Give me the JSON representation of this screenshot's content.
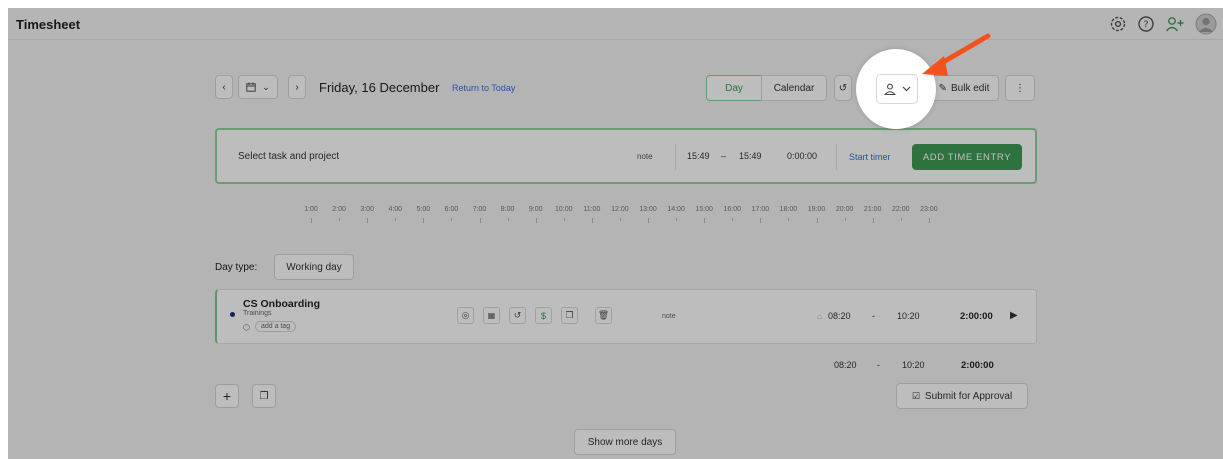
{
  "app": {
    "title": "Timesheet"
  },
  "top_icons": [
    "gear-icon",
    "help-icon",
    "add-user-icon",
    "avatar"
  ],
  "nav": {
    "date_label": "Friday, 16 December",
    "return_link": "Return to Today",
    "view_day": "Day",
    "view_calendar": "Calendar",
    "bulk_edit": "Bulk edit"
  },
  "entry": {
    "placeholder": "Select task and project",
    "note": "note",
    "start": "15:49",
    "dash": "–",
    "end": "15:49",
    "duration": "0:00:00",
    "start_timer": "Start timer",
    "add_button": "ADD TIME ENTRY"
  },
  "timeline_hours": [
    "1:00",
    "2:00",
    "3:00",
    "4:00",
    "5:00",
    "6:00",
    "7:00",
    "8:00",
    "9:00",
    "10:00",
    "11:00",
    "12:00",
    "13:00",
    "14:00",
    "15:00",
    "16:00",
    "17:00",
    "18:00",
    "19:00",
    "20:00",
    "21:00",
    "22:00",
    "23:00"
  ],
  "day_type": {
    "label": "Day type:",
    "value": "Working day"
  },
  "task": {
    "name": "CS Onboarding",
    "project": "Trainings",
    "tag_placeholder": "add a tag",
    "note": "note",
    "start": "08:20",
    "dash": "-",
    "end": "10:20",
    "duration": "2:00:00"
  },
  "totals": {
    "start": "08:20",
    "dash": "-",
    "end": "10:20",
    "duration": "2:00:00"
  },
  "actions": {
    "submit": "Submit for Approval",
    "show_more": "Show more days"
  },
  "colors": {
    "accent_green": "#3f9c55",
    "link_blue": "#3b6fd6",
    "arrow": "#f4511e",
    "dot": "#1f2f8a"
  }
}
